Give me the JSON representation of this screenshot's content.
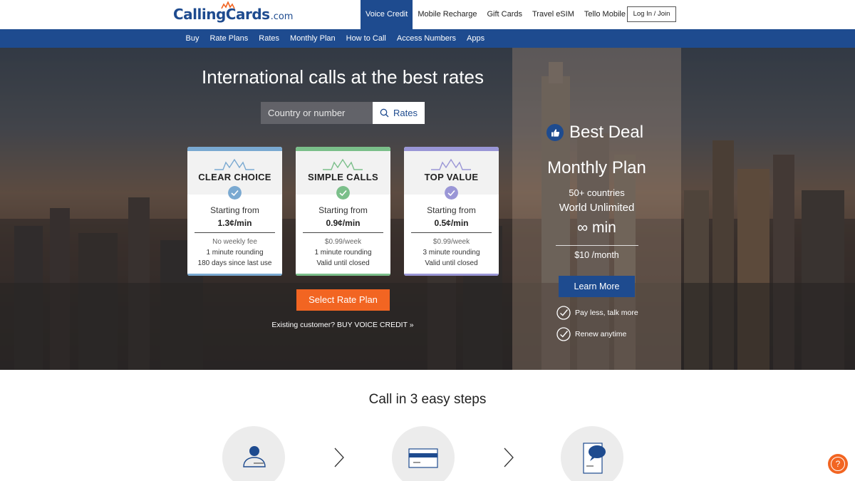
{
  "header": {
    "logo_brand": "CallingCards",
    "logo_tld": ".com",
    "nav": [
      "Voice Credit",
      "Mobile Recharge",
      "Gift Cards",
      "Travel eSIM",
      "Tello Mobile"
    ],
    "active_nav": "Voice Credit",
    "login_label": "Log In / Join",
    "accent_color": "#1e4b8f"
  },
  "subnav": {
    "links": [
      "Buy",
      "Rate Plans",
      "Rates",
      "Monthly Plan",
      "How to Call",
      "Access Numbers",
      "Apps"
    ]
  },
  "hero": {
    "title": "International calls at the best rates",
    "search_placeholder": "Country or number",
    "search_button": "Rates",
    "cards": [
      {
        "name": "CLEAR CHOICE",
        "from": "Starting from",
        "price": "1.3¢/min",
        "line1": "No weekly fee",
        "line2": "1 minute rounding",
        "line3": "180 days since last use",
        "color": "#7aa9d1"
      },
      {
        "name": "SIMPLE CALLS",
        "from": "Starting from",
        "price": "0.9¢/min",
        "line1": "$0.99/week",
        "line2": "1 minute rounding",
        "line3": "Valid until closed",
        "color": "#7bbf8a"
      },
      {
        "name": "TOP VALUE",
        "from": "Starting from",
        "price": "0.5¢/min",
        "line1": "$0.99/week",
        "line2": "3 minute rounding",
        "line3": "Valid until closed",
        "color": "#9a96d6"
      }
    ],
    "select_button": "Select Rate Plan",
    "select_button_color": "#f26522",
    "existing_link": "Existing customer? BUY VOICE CREDIT »"
  },
  "deal": {
    "heading": "Best Deal",
    "plan": "Monthly Plan",
    "countries": "50+ countries",
    "world": "World Unlimited",
    "minutes": "∞ min",
    "price": "$10 /month",
    "button": "Learn More",
    "perks": [
      "Pay less, talk more",
      "Renew anytime"
    ]
  },
  "steps": {
    "title": "Call in 3 easy steps",
    "icons": [
      "user-icon",
      "card-icon",
      "phone-chat-icon"
    ]
  },
  "help_label": "?"
}
